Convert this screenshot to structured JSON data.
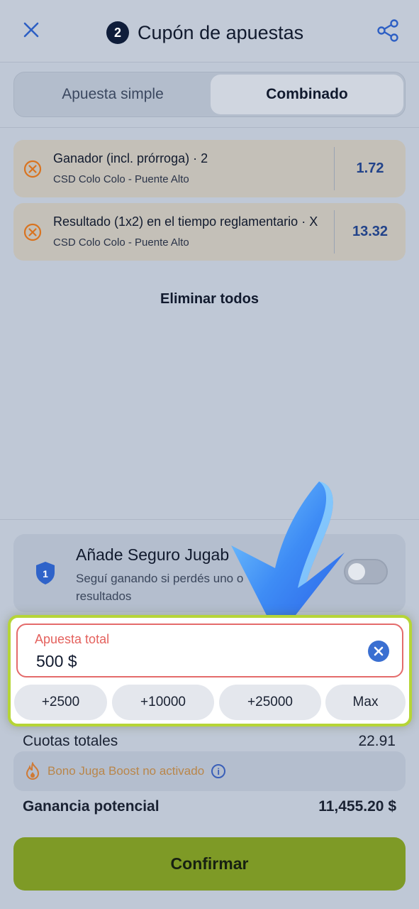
{
  "header": {
    "close_icon": "close-icon",
    "badge_count": "2",
    "title": "Cupón de apuestas",
    "share_icon": "share-icon"
  },
  "tabs": [
    {
      "label": "Apuesta simple",
      "active": false
    },
    {
      "label": "Combinado",
      "active": true
    }
  ],
  "bets": [
    {
      "market": "Ganador (incl. prórroga)",
      "selection": "· 2",
      "match": "CSD Colo Colo - Puente Alto",
      "odds": "1.72"
    },
    {
      "market": "Resultado (1x2) en el tiempo reglamentario",
      "selection": "· X",
      "match": "CSD Colo Colo - Puente Alto",
      "odds": "13.32"
    }
  ],
  "delete_all": "Eliminar todos",
  "insurance": {
    "title": "Añade Seguro Jugab",
    "description": "Seguí ganando si perdés uno o",
    "description2": "resultados",
    "shield_number": "1",
    "enabled": false
  },
  "stake": {
    "label": "Apuesta total",
    "value": "500 $",
    "quick_amounts": [
      "+2500",
      "+10000",
      "+25000",
      "Max"
    ]
  },
  "totals": {
    "odds_label": "Cuotas totales",
    "odds_value": "22.91",
    "boost_text": "Bono Juga Boost no activado",
    "potential_label": "Ganancia potencial",
    "potential_value": "11,455.20 $"
  },
  "confirm_label": "Confirmar",
  "colors": {
    "accent_green": "#7e9a26",
    "highlight": "#b6d536",
    "odds_blue": "#22438a",
    "error_red": "#e46b6b"
  }
}
